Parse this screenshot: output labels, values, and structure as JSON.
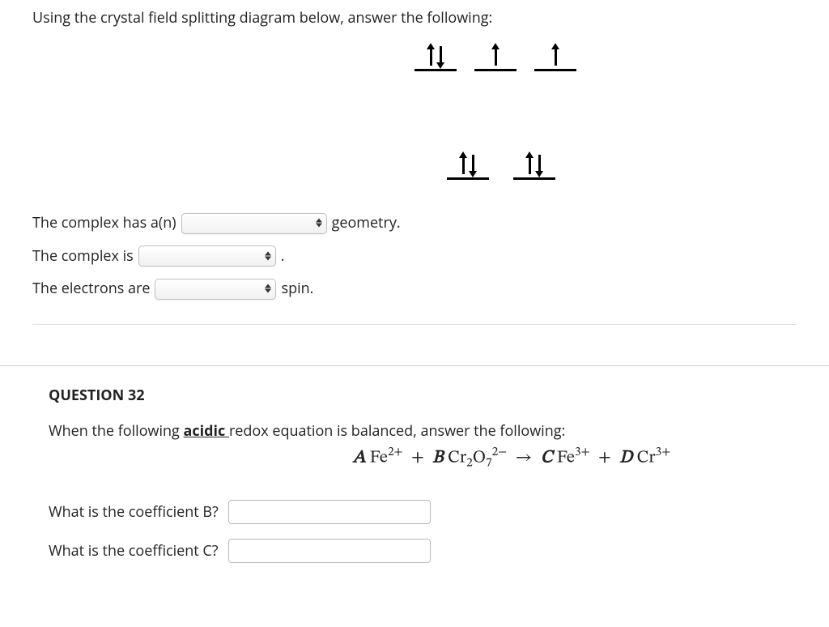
{
  "q31": {
    "intro": "Using the crystal field splitting diagram below, answer the following:",
    "diagram": {
      "upper": [
        {
          "electrons": [
            "up",
            "down"
          ]
        },
        {
          "electrons": [
            "up"
          ]
        },
        {
          "electrons": [
            "up"
          ]
        }
      ],
      "lower": [
        {
          "electrons": [
            "up",
            "down"
          ]
        },
        {
          "electrons": [
            "up",
            "down"
          ]
        }
      ]
    },
    "line1_pre": "The complex has a(n)",
    "line1_post": "geometry.",
    "line2_pre": "The complex is",
    "line2_post": ".",
    "line3_pre": "The electrons are",
    "line3_post": "spin."
  },
  "q32": {
    "label": "QUESTION 32",
    "intro_pre": "When the following ",
    "intro_acidic": "acidic ",
    "intro_post": "redox equation is balanced, answer the following:",
    "equation": {
      "A": "A",
      "B": "B",
      "C": "C",
      "D": "D",
      "species1": "Fe",
      "charge1": "2+",
      "species2": "Cr",
      "sub2a": "2",
      "species2b": "O",
      "sub2b": "7",
      "charge2": "2−",
      "arrow": "→",
      "species3": "Fe",
      "charge3": "3+",
      "species4": "Cr",
      "charge4": "3+"
    },
    "promptB": "What is the coefficient B?",
    "promptC": "What is the coefficient C?"
  }
}
